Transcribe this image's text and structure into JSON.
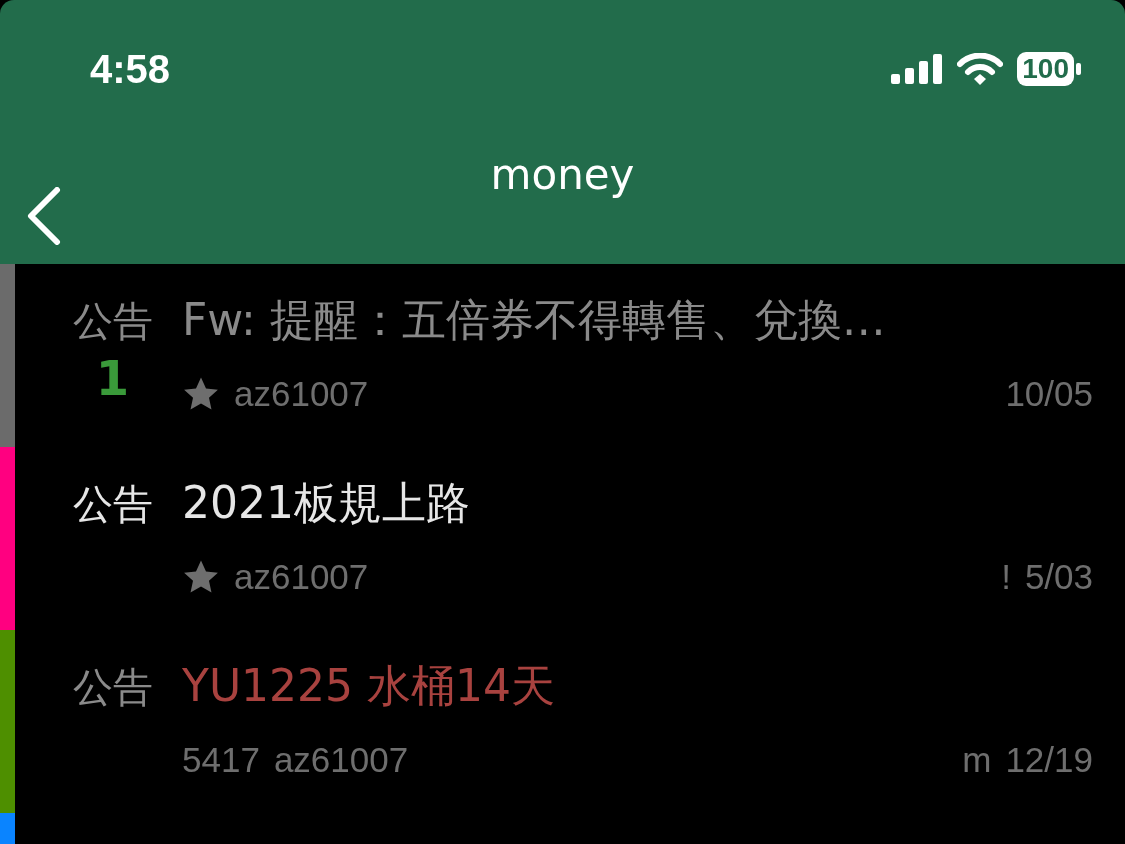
{
  "status_bar": {
    "time": "4:58",
    "battery": "100"
  },
  "nav": {
    "title": "money"
  },
  "posts": [
    {
      "color": "#6b6b6b",
      "category": "公告",
      "count": "1",
      "title": "Fw: 提醒：五倍券不得轉售、兌換…",
      "kind": "read",
      "starred": true,
      "author": "az61007",
      "date": "10/05"
    },
    {
      "color": "#ff0080",
      "category": "公告",
      "title": "2021板規上路",
      "kind": "unread",
      "starred": true,
      "author": "az61007",
      "mark": "!",
      "date": "5/03"
    },
    {
      "color": "#4e8f00",
      "category": "公告",
      "title": "YU1225 水桶14天",
      "kind": "marked",
      "starred": false,
      "number": "5417",
      "author": "az61007",
      "mark": "m",
      "date": "12/19"
    },
    {
      "color": "#0a84ff"
    }
  ]
}
